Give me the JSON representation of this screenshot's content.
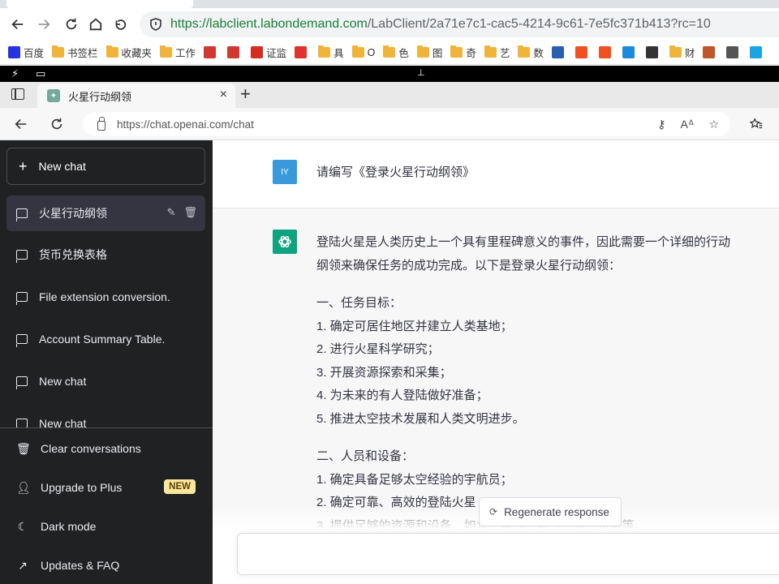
{
  "outer_browser": {
    "address": {
      "scheme": "https://",
      "host": "labclient.labondemand.com",
      "path": "/LabClient/2a71e7c1-cac5-4214-9c61-7e5fc371b413?rc=10"
    },
    "bookmarks": [
      {
        "label": "百度",
        "icon": "baidu-paw-icon"
      },
      {
        "label": "书签栏",
        "icon": "folder-icon"
      },
      {
        "label": "收藏夹",
        "icon": "folder-icon"
      },
      {
        "label": "工作",
        "icon": "folder-icon"
      },
      {
        "label": "",
        "icon": "colorful-app-icon"
      },
      {
        "label": "",
        "icon": "colorful-app-icon"
      },
      {
        "label": "证监",
        "icon": "red-triangle-icon"
      },
      {
        "label": "",
        "icon": "red-book-icon"
      },
      {
        "label": "具",
        "icon": "folder-icon"
      },
      {
        "label": "O",
        "icon": "folder-icon"
      },
      {
        "label": "色",
        "icon": "folder-icon"
      },
      {
        "label": "图",
        "icon": "folder-icon"
      },
      {
        "label": "奇",
        "icon": "folder-icon"
      },
      {
        "label": "艺",
        "icon": "folder-icon"
      },
      {
        "label": "数",
        "icon": "folder-icon"
      },
      {
        "label": "",
        "icon": "stack-icon"
      },
      {
        "label": "",
        "icon": "windows-logo-icon"
      },
      {
        "label": "",
        "icon": "windows-logo-icon"
      },
      {
        "label": "",
        "icon": "blue-app-icon"
      },
      {
        "label": "",
        "icon": "dots-icon"
      },
      {
        "label": "财",
        "icon": "folder-icon"
      },
      {
        "label": "",
        "icon": "cube-icon"
      },
      {
        "label": "",
        "icon": "globe-icon"
      },
      {
        "label": "",
        "icon": "cyan-app-icon"
      }
    ]
  },
  "inner_browser": {
    "tab_title": "火星行动纲领",
    "tab_close": "×",
    "new_tab": "+",
    "address": "https://chat.openai.com/chat"
  },
  "sidebar": {
    "new_chat_label": "New chat",
    "chats": [
      {
        "label": "火星行动纲领",
        "active": true
      },
      {
        "label": "货币兑换表格",
        "active": false
      },
      {
        "label": "File extension conversion.",
        "active": false
      },
      {
        "label": "Account Summary Table.",
        "active": false
      },
      {
        "label": "New chat",
        "active": false
      },
      {
        "label": "New chat",
        "active": false
      }
    ],
    "bottom": {
      "clear": "Clear conversations",
      "upgrade": "Upgrade to Plus",
      "upgrade_badge": "NEW",
      "dark_mode": "Dark mode",
      "updates": "Updates & FAQ"
    }
  },
  "conversation": {
    "user_avatar": "IY",
    "user_message": "请编写《登录火星行动纲领》",
    "bot_paragraphs": [
      [
        "登陆火星是人类历史上一个具有里程碑意义的事件，因此需要一个详细的行动",
        "纲领来确保任务的成功完成。以下是登录火星行动纲领："
      ],
      [
        "一、任务目标：",
        "1. 确定可居住地区并建立人类基地；",
        "2. 进行火星科学研究；",
        "3. 开展资源探索和采集；",
        "4. 为未来的有人登陆做好准备；",
        "5. 推进太空技术发展和人类文明进步。"
      ],
      [
        "二、人员和设备：",
        "1. 确定具备足够太空经验的宇航员；",
        "2. 确定可靠、高效的登陆火星",
        "3. 提供足够的资源和设备，如水、食物、氧气、通讯设备等。"
      ]
    ],
    "regenerate_label": "Regenerate response"
  },
  "colors": {
    "sidebar_bg": "#202123",
    "bot_row_bg": "#f7f7f8",
    "openai_green": "#10a37f",
    "user_avatar_blue": "#3a9ad9",
    "badge_yellow": "#fae69e"
  }
}
